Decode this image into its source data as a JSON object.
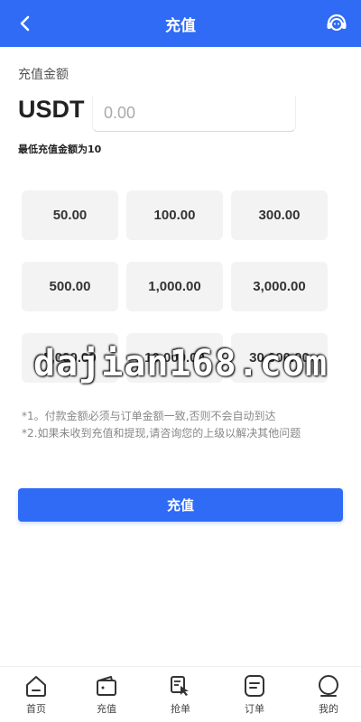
{
  "header": {
    "title": "充值",
    "back_icon": "chevron-left-icon",
    "service_icon": "customer-service-icon",
    "bg_color": "#2f6bf5"
  },
  "form": {
    "amount_label": "充值金额",
    "currency": "USDT",
    "amount_placeholder": "0.00",
    "amount_value": "",
    "min_note": "最低充值金额为10"
  },
  "presets": [
    "50.00",
    "100.00",
    "300.00",
    "500.00",
    "1,000.00",
    "3,000.00",
    "5,000.00",
    "10,000.00",
    "30,000.00"
  ],
  "watermark": "dajian168.com",
  "notes": [
    "*1。付款金额必须与订单金额一致,否则不会自动到达",
    "*2.如果未收到充值和提现,请咨询您的上级以解决其他问题"
  ],
  "submit_label": "充值",
  "tabs": [
    {
      "label": "首页",
      "icon": "home-icon"
    },
    {
      "label": "充值",
      "icon": "wallet-icon"
    },
    {
      "label": "抢单",
      "icon": "grab-order-icon"
    },
    {
      "label": "订单",
      "icon": "orders-icon"
    },
    {
      "label": "我的",
      "icon": "profile-icon"
    }
  ]
}
